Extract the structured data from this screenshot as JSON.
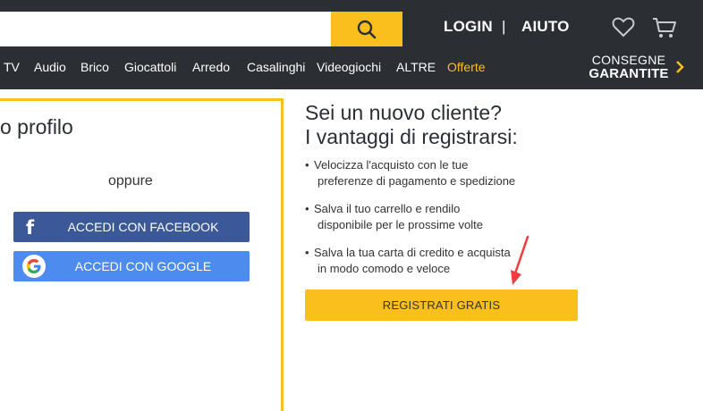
{
  "header": {
    "search": {
      "value": "",
      "placeholder": ""
    },
    "search_icon": "search-icon",
    "login_label": "LOGIN",
    "separator": "|",
    "help_label": "AIUTO",
    "wishlist_icon": "heart-icon",
    "cart_icon": "cart-icon"
  },
  "nav": {
    "categories": [
      "TV",
      "Audio",
      "Brico",
      "Giocattoli",
      "Arredo",
      "Casalinghi",
      "Videogiochi",
      "ALTRE",
      "Offerte"
    ],
    "delivery_line1": "CONSEGNE",
    "delivery_line2": "GARANTITE",
    "delivery_icon": "chevron-right-icon"
  },
  "login_panel": {
    "title": "o profilo",
    "or_text": "oppure",
    "facebook_label": "ACCEDI CON FACEBOOK",
    "google_label": "ACCEDI CON GOOGLE"
  },
  "register_panel": {
    "title_line1": "Sei un nuovo cliente?",
    "title_line2": "I vantaggi di registrarsi:",
    "benefits": [
      {
        "line1": "Velocizza l'acquisto con le tue",
        "line2": "preferenze di pagamento e spedizione"
      },
      {
        "line1": "Salva il tuo carrello e rendilo",
        "line2": "disponibile per le prossime volte"
      },
      {
        "line1": "Salva la tua carta di credito e acquista",
        "line2": "in modo comodo e veloce"
      }
    ],
    "register_label": "REGISTRATI GRATIS"
  },
  "colors": {
    "header_bg": "#2b2e33",
    "accent": "#fbbf1d",
    "facebook": "#3b5998",
    "google": "#4d8bef",
    "annotation_arrow": "#f03c3c"
  }
}
